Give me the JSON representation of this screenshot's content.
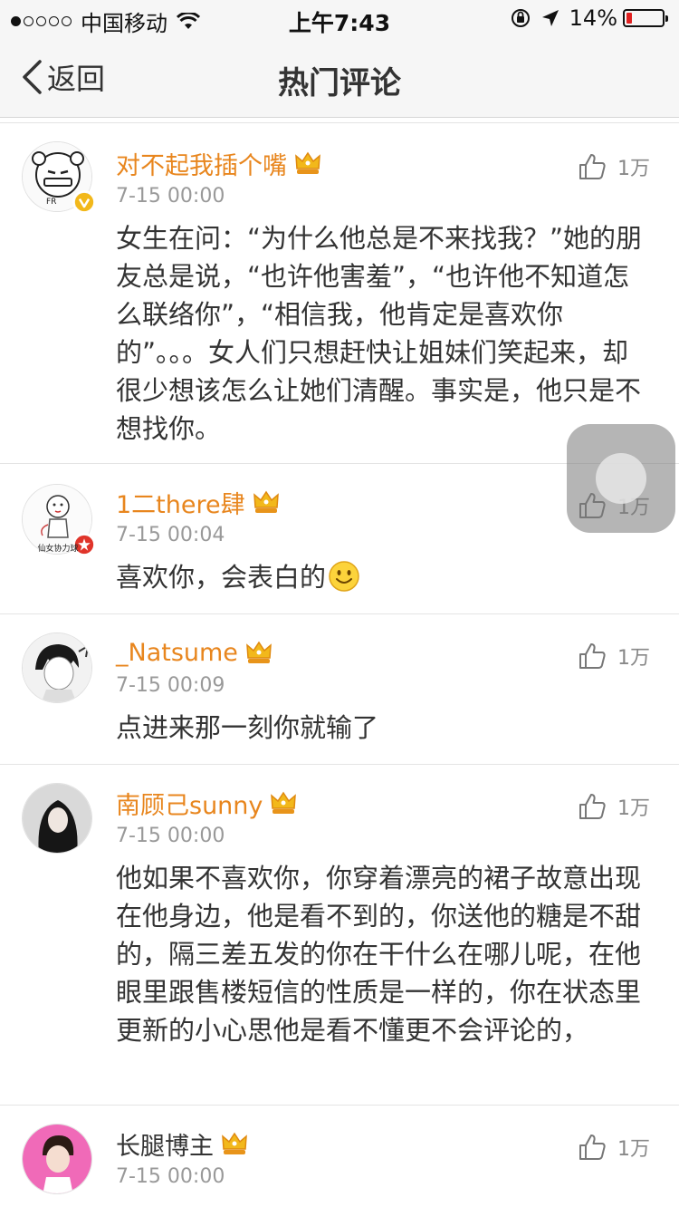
{
  "status_bar": {
    "carrier": "中国移动",
    "time": "上午7:43",
    "battery": "14%",
    "signal_bars_filled": 1,
    "signal_bars_total": 5,
    "battery_level": 0.14
  },
  "nav": {
    "back_label": "返回",
    "title": "热门评论"
  },
  "colors": {
    "username": "#e8861e",
    "timestamp": "#999999",
    "text": "#333333",
    "battery_low": "#e02020"
  },
  "comments": [
    {
      "username": "对不起我插个嘴",
      "time": "7-15 00:00",
      "likes": "1万",
      "text": "女生在问：“为什么他总是不来找我？”她的朋友总是说，“也许他害羞”，“也许他不知道怎么联络你”，“相信我，他肯定是喜欢你的”。。。女人们只想赶快让姐妹们笑起来，却很少想该怎么让她们清醒。事实是，他只是不想找你。",
      "avatar_label": "",
      "avatar_icon": "cartoon-face-icon",
      "badge": "gold-v-icon"
    },
    {
      "username": "1二there肆",
      "time": "7-15 00:04",
      "likes": "1万",
      "text": "喜欢你，会表白的",
      "avatar_label": "仙女协力球",
      "avatar_icon": "cartoon-figure-icon",
      "badge": "red-star-icon",
      "emoji": "smiley-emoji-icon"
    },
    {
      "username": "_Natsume",
      "time": "7-15 00:09",
      "likes": "1万",
      "text": "点进来那一刻你就输了",
      "avatar_icon": "anime-boy-icon"
    },
    {
      "username": "南顾己sunny",
      "time": "7-15 00:00",
      "likes": "1万",
      "text": "他如果不喜欢你，你穿着漂亮的裙子故意出现在他身边，他是看不到的，你送他的糖是不甜的，隔三差五发的你在干什么在哪儿呢，在他眼里跟售楼短信的性质是一样的，你在状态里更新的小心思他是看不懂更不会评论的，",
      "avatar_icon": "girl-photo-icon"
    },
    {
      "username": "长腿博主",
      "time": "7-15 00:00",
      "likes": "1万",
      "text": "",
      "avatar_icon": "boy-photo-icon"
    }
  ]
}
